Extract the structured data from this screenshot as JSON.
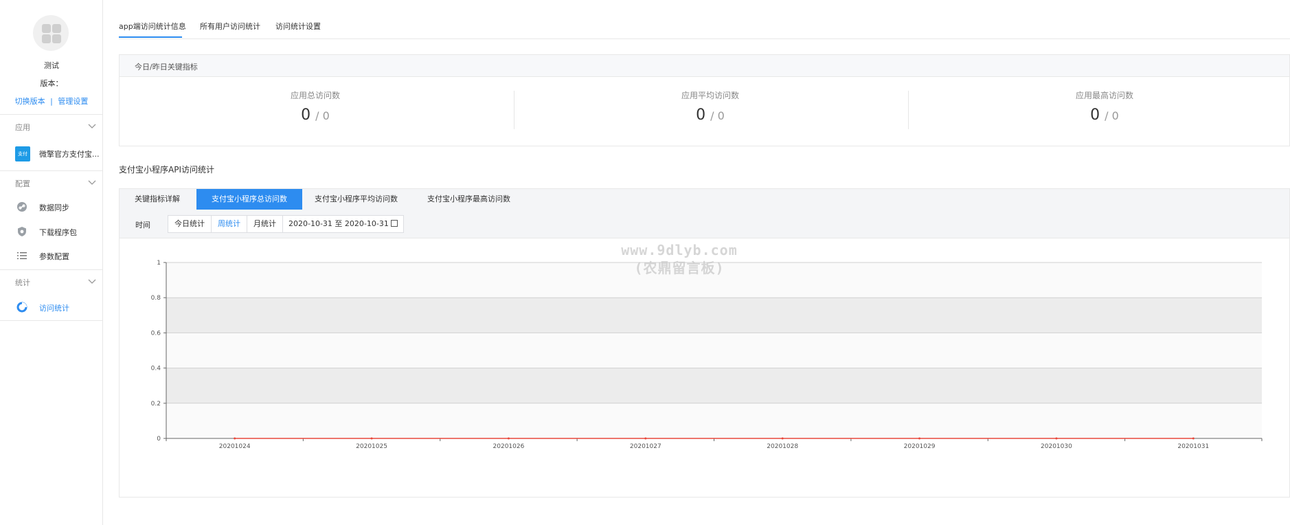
{
  "sidebar": {
    "app_name": "测试",
    "version_label": "版本：",
    "links": {
      "switch_version": "切换版本",
      "separator": "|",
      "manage_settings": "管理设置"
    },
    "sections": [
      {
        "label": "应用",
        "items": [
          {
            "label": "微擎官方支付宝...",
            "icon": "app-thumbnail"
          }
        ]
      },
      {
        "label": "配置",
        "items": [
          {
            "label": "数据同步",
            "icon": "link-icon"
          },
          {
            "label": "下载程序包",
            "icon": "shield-icon"
          },
          {
            "label": "参数配置",
            "icon": "list-icon"
          }
        ]
      },
      {
        "label": "统计",
        "items": [
          {
            "label": "访问统计",
            "icon": "pie-icon",
            "active": true
          }
        ]
      }
    ]
  },
  "tabs": [
    {
      "label": "app端访问统计信息",
      "active": true
    },
    {
      "label": "所有用户访问统计"
    },
    {
      "label": "访问统计设置"
    }
  ],
  "key_metrics": {
    "title": "今日/昨日关键指标",
    "items": [
      {
        "label": "应用总访问数",
        "today": "0",
        "yesterday": "/ 0"
      },
      {
        "label": "应用平均访问数",
        "today": "0",
        "yesterday": "/ 0"
      },
      {
        "label": "应用最高访问数",
        "today": "0",
        "yesterday": "/ 0"
      }
    ]
  },
  "api_section": {
    "title": "支付宝小程序API访问统计",
    "tabs": [
      {
        "label": "关键指标详解"
      },
      {
        "label": "支付宝小程序总访问数",
        "active": true
      },
      {
        "label": "支付宝小程序平均访问数"
      },
      {
        "label": "支付宝小程序最高访问数"
      }
    ],
    "filter": {
      "label": "时间",
      "buttons": [
        {
          "label": "今日统计"
        },
        {
          "label": "周统计",
          "active": true
        },
        {
          "label": "月统计"
        }
      ],
      "date_range": "2020-10-31 至 2020-10-31"
    }
  },
  "watermark": {
    "line1": "www.9dlyb.com",
    "line2": "(农鼎留言板)"
  },
  "colors": {
    "accent": "#2d8cf0",
    "series": "#e8473a",
    "band": "#ececec"
  },
  "chart_data": {
    "type": "line",
    "x": [
      "20201024",
      "20201025",
      "20201026",
      "20201027",
      "20201028",
      "20201029",
      "20201030",
      "20201031"
    ],
    "series": [
      {
        "values": [
          0,
          0,
          0,
          0,
          0,
          0,
          0,
          0
        ]
      }
    ],
    "ylim": [
      0,
      1
    ],
    "yticks": [
      "0",
      "0.2",
      "0.4",
      "0.6",
      "0.8",
      "1"
    ],
    "grid": true,
    "xlabel": "",
    "ylabel": ""
  }
}
